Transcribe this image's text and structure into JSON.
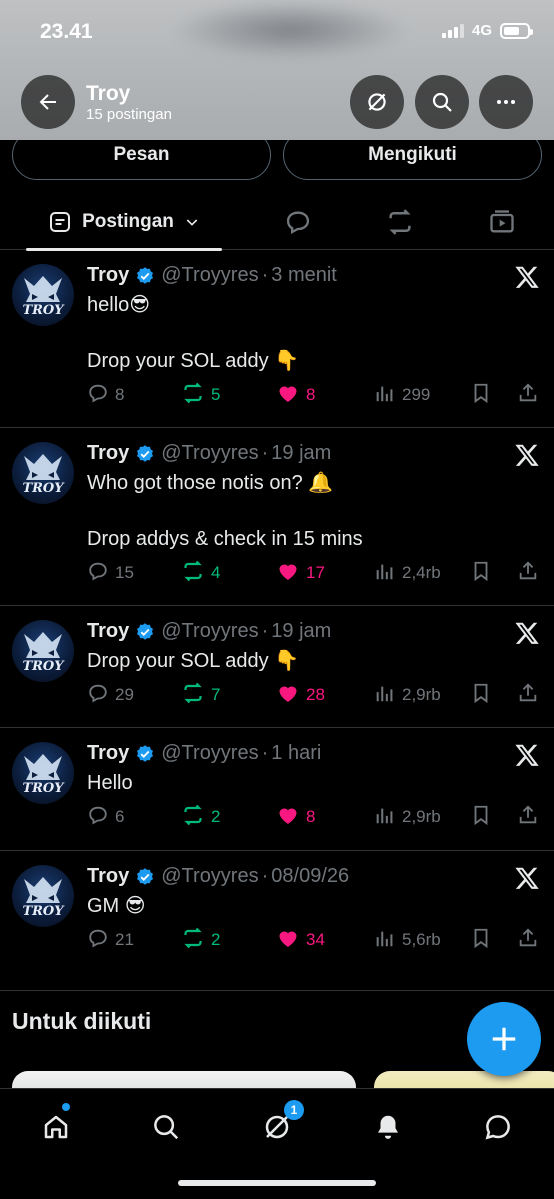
{
  "status_bar": {
    "time": "23.41",
    "network": "4G"
  },
  "header": {
    "title": "Troy",
    "subtitle": "15 postingan"
  },
  "profile_buttons": {
    "message": "Pesan",
    "following": "Mengikuti"
  },
  "tabs": {
    "posts_label": "Postingan"
  },
  "posts": [
    {
      "name": "Troy",
      "handle": "@Troyyres",
      "time": "3 menit",
      "lines": [
        "hello😎",
        "",
        "Drop your SOL addy 👇"
      ],
      "replies": "8",
      "reposts": "5",
      "likes": "8",
      "views": "299"
    },
    {
      "name": "Troy",
      "handle": "@Troyyres",
      "time": "19 jam",
      "lines": [
        "Who got those notis on? 🔔",
        "",
        "Drop addys & check in 15 mins"
      ],
      "replies": "15",
      "reposts": "4",
      "likes": "17",
      "views": "2,4rb"
    },
    {
      "name": "Troy",
      "handle": "@Troyyres",
      "time": "19 jam",
      "lines": [
        "Drop your SOL addy 👇"
      ],
      "replies": "29",
      "reposts": "7",
      "likes": "28",
      "views": "2,9rb"
    },
    {
      "name": "Troy",
      "handle": "@Troyyres",
      "time": "1 hari",
      "lines": [
        "Hello"
      ],
      "replies": "6",
      "reposts": "2",
      "likes": "8",
      "views": "2,9rb"
    },
    {
      "name": "Troy",
      "handle": "@Troyyres",
      "time": "08/09/26",
      "lines": [
        "GM 😎"
      ],
      "replies": "21",
      "reposts": "2",
      "likes": "34",
      "views": "5,6rb"
    }
  ],
  "suggestions": {
    "title": "Untuk diikuti"
  },
  "bottom_nav": {
    "grok_badge": "1"
  },
  "colors": {
    "accent": "#1d9bf0",
    "repost": "#00ba7c",
    "like": "#f91880",
    "muted": "#71767b"
  }
}
